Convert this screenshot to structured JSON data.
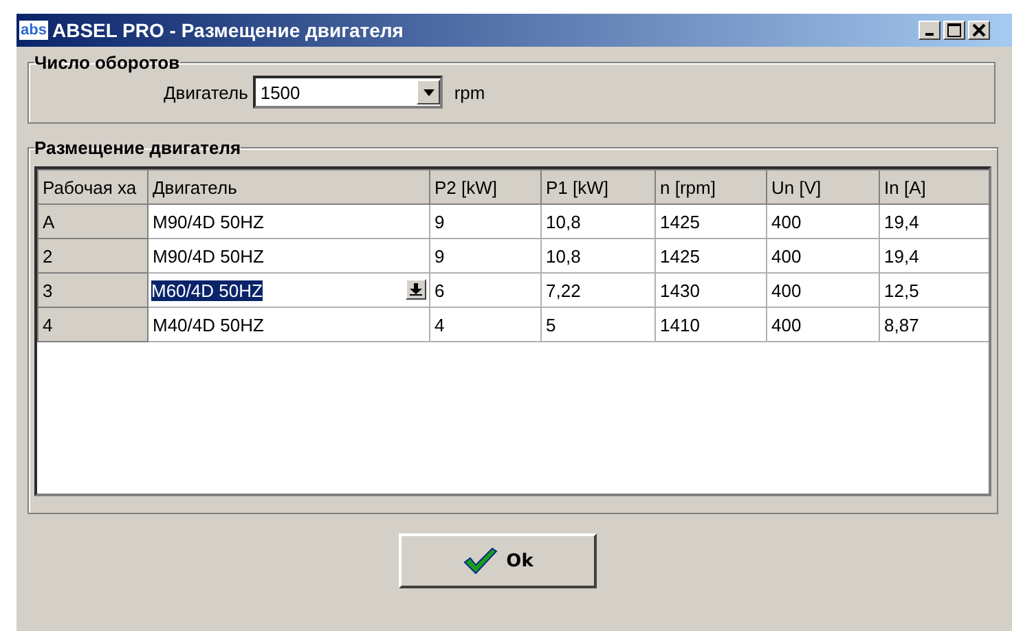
{
  "window": {
    "title": "ABSEL PRO - Размещение двигателя",
    "app_icon": "abs"
  },
  "speed_group": {
    "title": "Число оборотов",
    "label": "Двигатель",
    "value": "1500",
    "unit": "rpm"
  },
  "placement_group": {
    "title": "Размещение двигателя",
    "table": {
      "columns": [
        "Рабочая ха",
        "Двигатель",
        "P2 [kW]",
        "P1 [kW]",
        "n [rpm]",
        "Un [V]",
        "In [A]"
      ],
      "rows": [
        {
          "cells": [
            "A",
            "M90/4D 50HZ",
            "9",
            "10,8",
            "1425",
            "400",
            "19,4"
          ],
          "selected": false
        },
        {
          "cells": [
            "2",
            "M90/4D 50HZ",
            "9",
            "10,8",
            "1425",
            "400",
            "19,4"
          ],
          "selected": false
        },
        {
          "cells": [
            "3",
            "M60/4D 50HZ",
            "6",
            "7,22",
            "1430",
            "400",
            "12,5"
          ],
          "selected": true
        },
        {
          "cells": [
            "4",
            "M40/4D 50HZ",
            "4",
            "5",
            "1410",
            "400",
            "8,87"
          ],
          "selected": false
        }
      ]
    }
  },
  "buttons": [
    {
      "label": "Ok"
    }
  ]
}
